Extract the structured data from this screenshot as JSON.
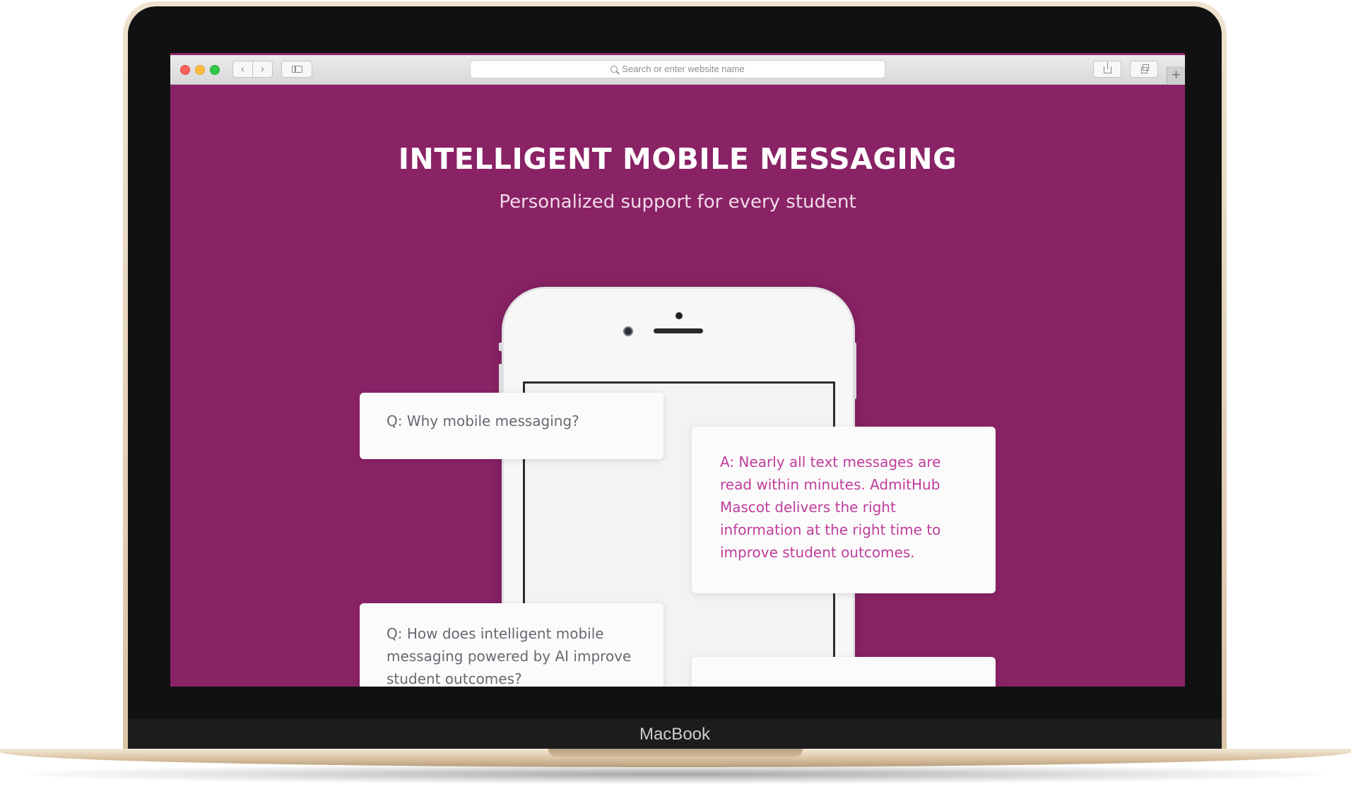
{
  "device": {
    "brand": "MacBook"
  },
  "browser": {
    "address_placeholder": "Search or enter website name",
    "new_tab_symbol": "+"
  },
  "page": {
    "title": "INTELLIGENT MOBILE MESSAGING",
    "subtitle": "Personalized support for every student"
  },
  "cards": [
    {
      "type": "question",
      "text": "Q: Why mobile messaging?"
    },
    {
      "type": "answer",
      "text": "A: Nearly all text messages are read within minutes. AdmitHub Mascot delivers the right information at the right time to improve student outcomes."
    },
    {
      "type": "question",
      "text": "Q: How does intelligent mobile messaging powered by AI improve student outcomes?"
    },
    {
      "type": "answer",
      "text": ""
    }
  ],
  "icons": [
    "back-chevron-icon",
    "forward-chevron-icon",
    "sidebar-icon",
    "search-icon",
    "share-icon",
    "tabs-icon",
    "plus-icon"
  ],
  "colors": {
    "page_background": "#8a2266",
    "answer_text": "#c03d9a",
    "question_text": "#666a70",
    "traffic_red": "#fc605b",
    "traffic_yellow": "#fdbc40",
    "traffic_green": "#34c84a"
  }
}
